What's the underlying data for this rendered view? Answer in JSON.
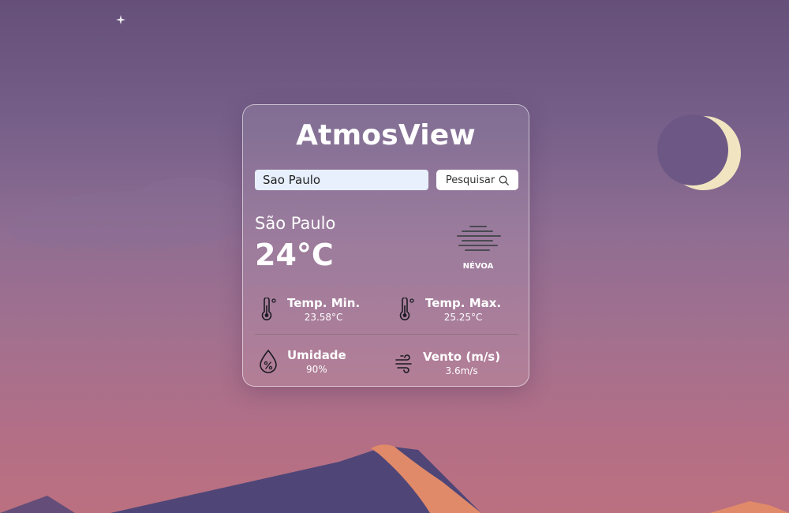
{
  "app": {
    "title": "AtmosView"
  },
  "search": {
    "value": "Sao Paulo",
    "button_label": "Pesquisar"
  },
  "weather": {
    "city": "São Paulo",
    "temperature": "24°C",
    "condition": "NÉVOA",
    "condition_icon": "fog-icon"
  },
  "stats": {
    "temp_min": {
      "label": "Temp. Min.",
      "value": "23.58°C",
      "icon": "thermometer-icon"
    },
    "temp_max": {
      "label": "Temp. Max.",
      "value": "25.25°C",
      "icon": "thermometer-icon"
    },
    "humidity": {
      "label": "Umidade",
      "value": "90%",
      "icon": "humidity-drop-icon"
    },
    "wind": {
      "label": "Vento (m/s)",
      "value": "3.6m/s",
      "icon": "wind-icon"
    }
  },
  "colors": {
    "moon": "#f1e5c1",
    "dune": "#e08a6a",
    "dune_shadow": "#4f4677"
  }
}
